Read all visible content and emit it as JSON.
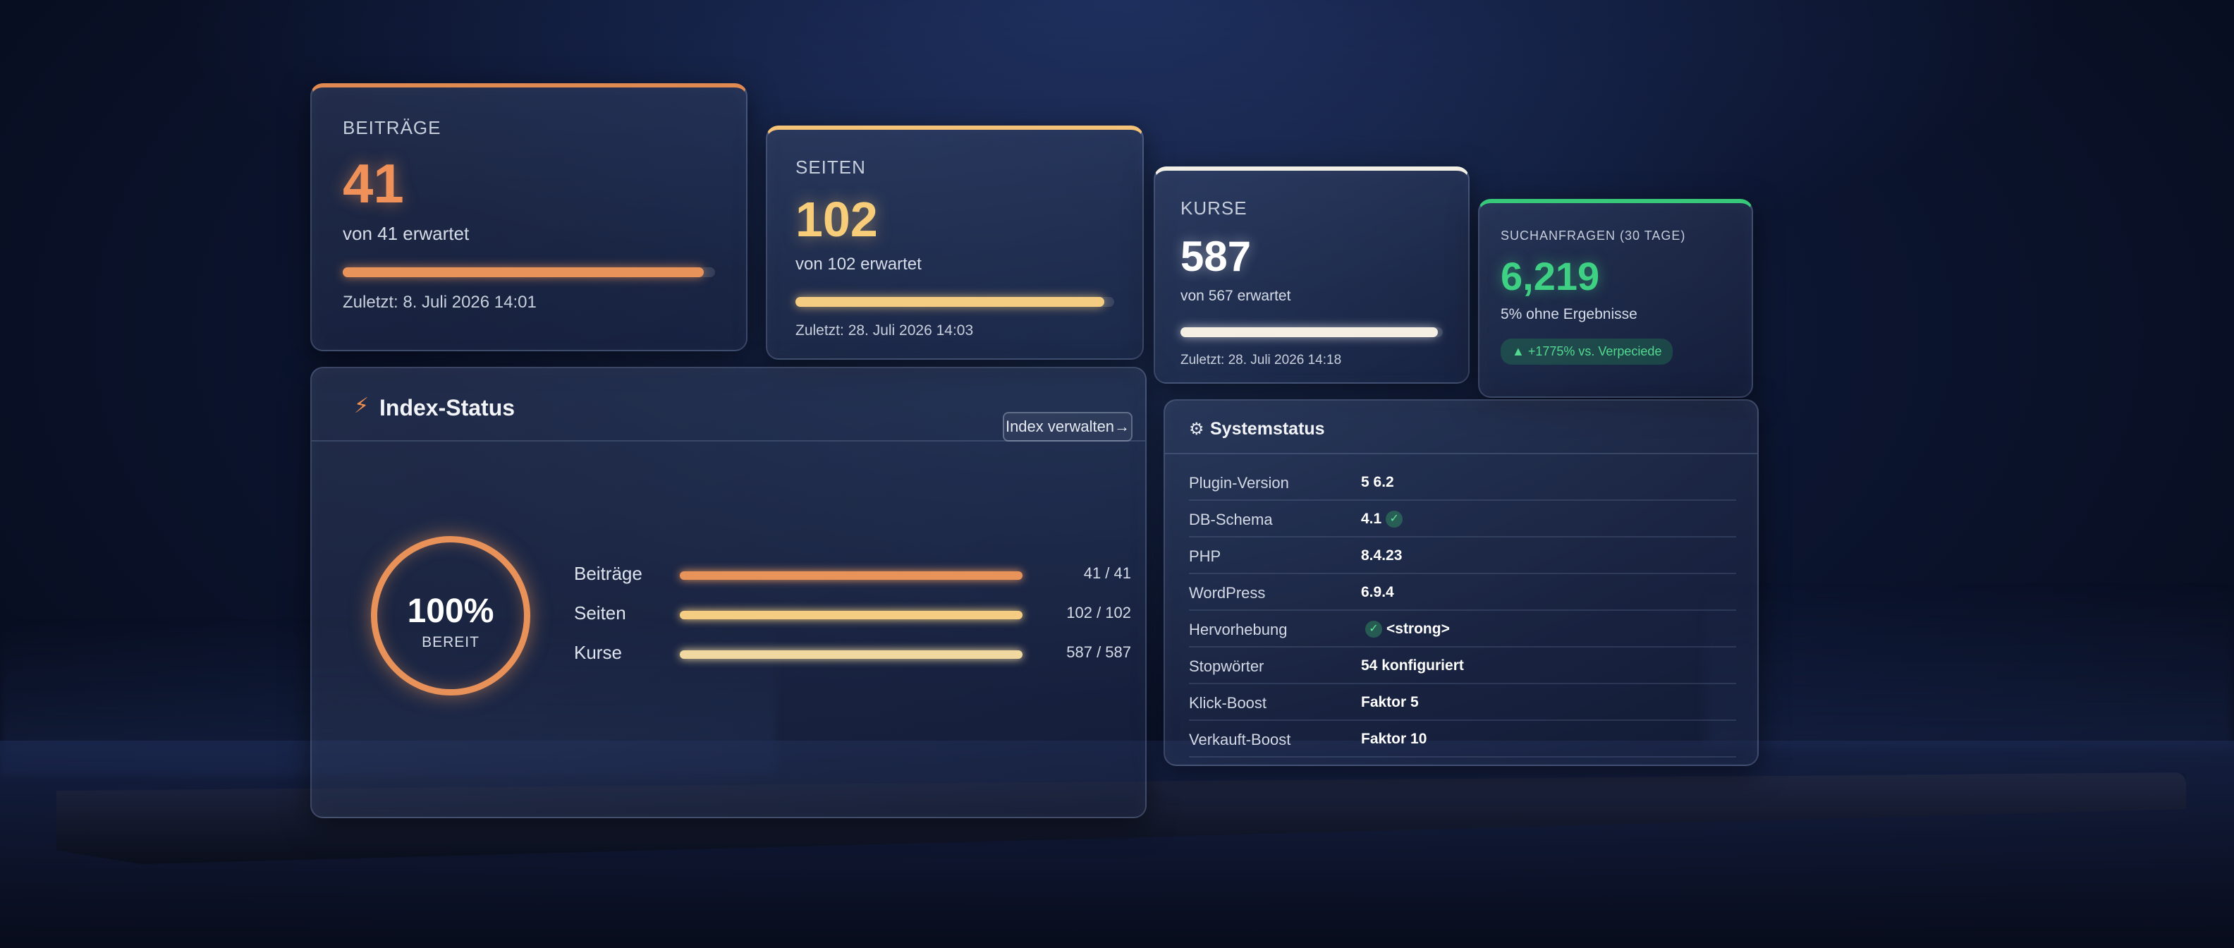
{
  "cards": [
    {
      "label": "BEITRÄGE",
      "value": "41",
      "sub": "von 41 erwartet",
      "progress": 0.97,
      "last": "Zuletzt: 8. Juli 2026 14:01"
    },
    {
      "label": "SEITEN",
      "value": "102",
      "sub": "von 102 erwartet",
      "progress": 0.97,
      "last": "Zuletzt: 28. Juli 2026 14:03"
    },
    {
      "label": "KURSE",
      "value": "587",
      "sub": "von 567 erwartet",
      "progress": 0.98,
      "last": "Zuletzt: 28. Juli 2026 14:18"
    },
    {
      "label": "SUCHANFRAGEN (30 TAGE)",
      "value": "6,219",
      "sub": "5% ohne Ergebnisse",
      "trend": "▲ +1775% vs. Verpeciede"
    }
  ],
  "index": {
    "title": "Index-Status",
    "manage_label": "Index verwalten→",
    "ring_value": "100%",
    "ring_label": "BEREIT",
    "rows": [
      {
        "label": "Beiträge",
        "count": "41 / 41",
        "progress": 1.0,
        "color": "#e8935a"
      },
      {
        "label": "Seiten",
        "count": "102 / 102",
        "progress": 1.0,
        "color": "#f4cd82"
      },
      {
        "label": "Kurse",
        "count": "587 / 587",
        "progress": 1.0,
        "color": "#f1d8a0"
      }
    ]
  },
  "system": {
    "title": "Systemstatus",
    "rows": [
      {
        "key": "Plugin-Version",
        "value": "5 6.2",
        "check": false
      },
      {
        "key": "DB-Schema",
        "value": "4.1",
        "check": true,
        "check_after": true
      },
      {
        "key": "PHP",
        "value": "8.4.23",
        "check": false
      },
      {
        "key": "WordPress",
        "value": "6.9.4",
        "check": false
      },
      {
        "key": "Hervorhebung",
        "value": "<strong>",
        "check": true,
        "check_after": false
      },
      {
        "key": "Stopwörter",
        "value": "54 konfiguriert",
        "check": false
      },
      {
        "key": "Klick-Boost",
        "value": "Faktor 5",
        "check": false
      },
      {
        "key": "Verkauft-Boost",
        "value": "Faktor 10",
        "check": false
      }
    ]
  },
  "colors": {
    "orange": "#e8935a",
    "yellow": "#f4cd82",
    "white": "#f4efe2",
    "green": "#3fd183"
  }
}
